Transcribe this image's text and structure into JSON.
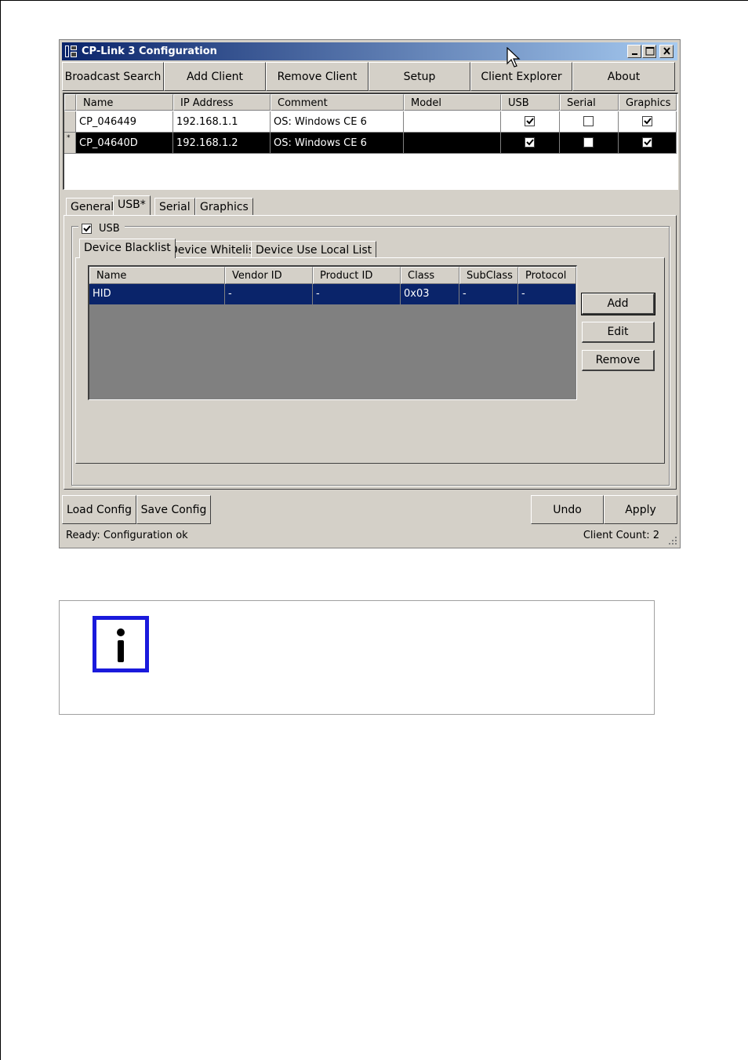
{
  "window": {
    "title": "CP-Link 3 Configuration"
  },
  "toolbar": {
    "broadcast_search": "Broadcast Search",
    "add_client": "Add Client",
    "remove_client": "Remove Client",
    "setup": "Setup",
    "client_explorer": "Client Explorer",
    "about": "About"
  },
  "clients": {
    "columns": [
      "Name",
      "IP Address",
      "Comment",
      "Model",
      "USB",
      "Serial",
      "Graphics"
    ],
    "rows": [
      {
        "marker": "",
        "name": "CP_046449",
        "ip": "192.168.1.1",
        "comment": "OS: Windows CE 6",
        "model": "",
        "usb": true,
        "serial": false,
        "graphics": true,
        "selected": false
      },
      {
        "marker": "*",
        "name": "CP_04640D",
        "ip": "192.168.1.2",
        "comment": "OS: Windows CE 6",
        "model": "",
        "usb": true,
        "serial": false,
        "graphics": true,
        "selected": true
      }
    ]
  },
  "tabs": {
    "general": "General",
    "usb": "USB*",
    "serial": "Serial",
    "graphics": "Graphics",
    "active": "USB*"
  },
  "usb_panel": {
    "enable_label": "USB",
    "enabled": true,
    "subtabs": {
      "blacklist": "Device Blacklist",
      "whitelist": "Device Whitelist",
      "local_list": "Device Use Local List",
      "active": "Device Blacklist"
    },
    "grid": {
      "columns": [
        "Name",
        "Vendor ID",
        "Product ID",
        "Class",
        "SubClass",
        "Protocol"
      ],
      "rows": [
        {
          "name": "HID",
          "vendor_id": "-",
          "product_id": "-",
          "class": "0x03",
          "subclass": "-",
          "protocol": "-"
        }
      ]
    },
    "buttons": {
      "add": "Add",
      "edit": "Edit",
      "remove": "Remove"
    }
  },
  "bottom_buttons": {
    "load_config": "Load Config",
    "save_config": "Save Config",
    "undo": "Undo",
    "apply": "Apply"
  },
  "status": {
    "left": "Ready: Configuration ok",
    "right": "Client Count: 2"
  },
  "colors": {
    "title_start": "#0a246a",
    "title_end": "#a6caf0",
    "selection": "#0a246a",
    "face": "#d4d0c8",
    "info_icon": "#1a1adc"
  },
  "icons": {
    "app": "app-icon",
    "minimize": "minimize-icon",
    "maximize": "maximize-icon",
    "close": "close-icon",
    "info": "info-icon",
    "cursor": "mouse-cursor-icon",
    "grip": "resize-grip-icon"
  }
}
